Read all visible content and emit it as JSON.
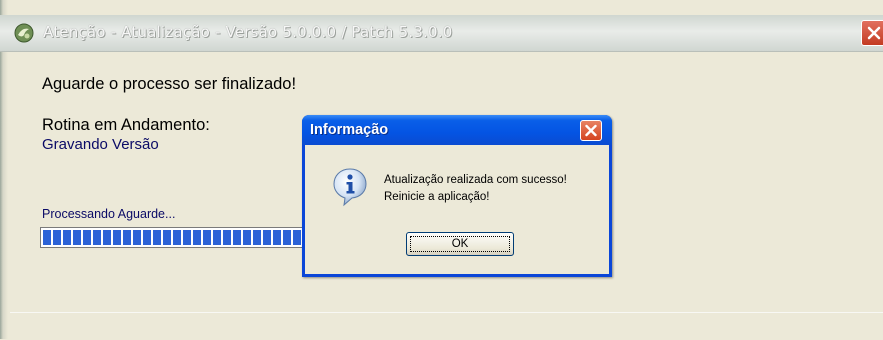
{
  "window": {
    "title": "Atenção - Atualização - Versão 5.0.0.0 / Patch 5.3.0.0"
  },
  "main": {
    "wait_message": "Aguarde o processo ser finalizado!",
    "routine_label": "Rotina em Andamento:",
    "routine_value": "Gravando Versão",
    "processing_label": "Processando Aguarde...",
    "progress_fraction": 0.47
  },
  "dialog": {
    "title": "Informação",
    "message_line1": "Atualização realizada com sucesso!",
    "message_line2": "Reinicie a aplicação!",
    "ok_label": "OK",
    "icon": "info-icon"
  },
  "colors": {
    "dialog_title_blue": "#0454e3",
    "progress_blue": "#2b62d7",
    "close_red": "#d54420"
  }
}
